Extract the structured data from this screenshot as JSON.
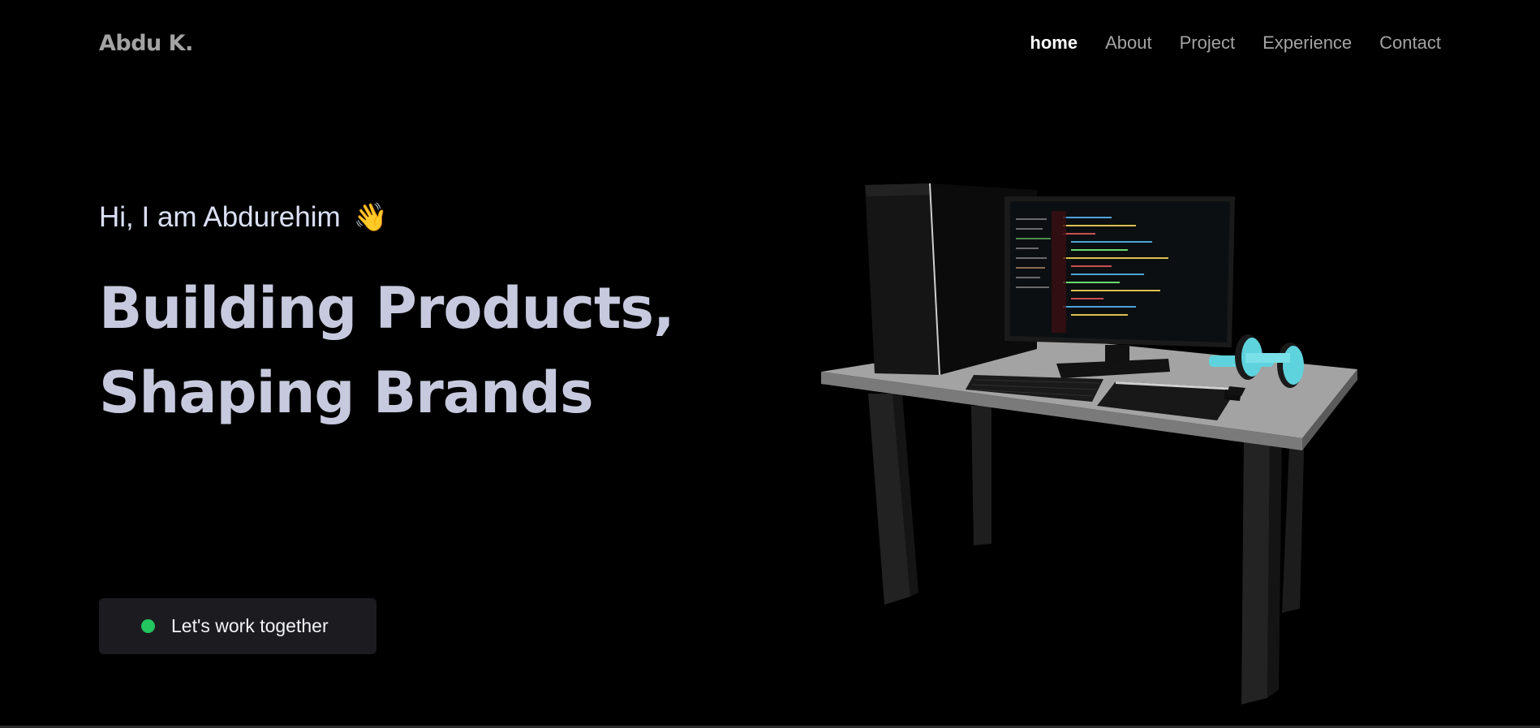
{
  "header": {
    "logo": "Abdu K.",
    "nav": [
      {
        "label": "home",
        "active": true
      },
      {
        "label": "About",
        "active": false
      },
      {
        "label": "Project",
        "active": false
      },
      {
        "label": "Experience",
        "active": false
      },
      {
        "label": "Contact",
        "active": false
      }
    ]
  },
  "hero": {
    "greeting": "Hi, I am Abdurehim",
    "wave_emoji": "👋",
    "headline_line1": "Building Products,",
    "headline_line2": "Shaping Brands",
    "cta_label": "Let's work together"
  },
  "illustration": {
    "description_icon": "desk-setup-3d-icon"
  },
  "colors": {
    "background": "#000000",
    "status_dot": "#22c55e",
    "headline": "#c7cade",
    "accent_dumbbell": "#5fd3dd"
  }
}
